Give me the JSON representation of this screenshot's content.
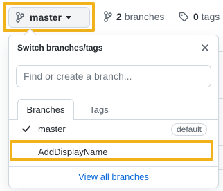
{
  "toolbar": {
    "branch_label": "master",
    "branches_count": "2",
    "branches_label": "branches",
    "tags_count": "0",
    "tags_label": "tags"
  },
  "dropdown": {
    "title": "Switch branches/tags",
    "filter_placeholder": "Find or create a branch...",
    "tabs": [
      {
        "label": "Branches",
        "active": true
      },
      {
        "label": "Tags",
        "active": false
      }
    ],
    "items": [
      {
        "name": "master",
        "selected": true,
        "badge": "default"
      },
      {
        "name": "AddDisplayName",
        "selected": false
      }
    ],
    "view_all_label": "View all branches"
  },
  "colors": {
    "highlight": "#f2b21b",
    "link": "#0969da"
  }
}
